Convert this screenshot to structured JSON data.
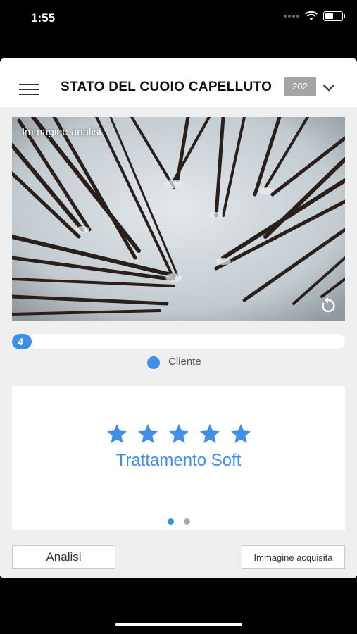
{
  "status_bar": {
    "time": "1:55"
  },
  "header": {
    "title": "STATO DEL CUOIO CAPELLUTO",
    "badge": "202"
  },
  "image_panel": {
    "label": "Immagine analisi"
  },
  "progress": {
    "value": "4",
    "fraction": 0.06
  },
  "legend": {
    "label": "Cliente"
  },
  "card": {
    "rating": 5,
    "treatment": "Trattamento Soft"
  },
  "pagination": {
    "pages": 2,
    "active": 0
  },
  "buttons": {
    "analisi": "Analisi",
    "immagine": "Immagine acquisita"
  },
  "colors": {
    "accent": "#3f8ee8",
    "badge": "#a5a5a5"
  }
}
